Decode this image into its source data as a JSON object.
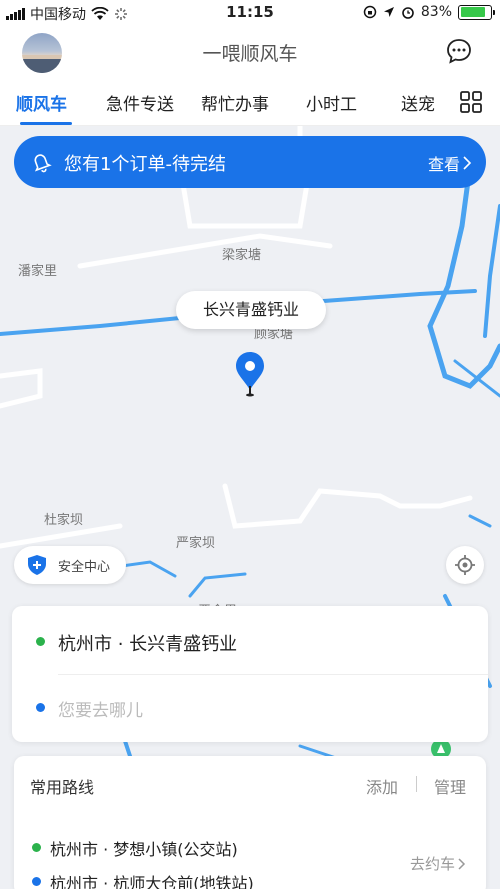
{
  "status_bar": {
    "carrier": "中国移动",
    "time": "11:15",
    "battery": "83%",
    "battery_level": 0.83
  },
  "header": {
    "title": "一喂顺风车"
  },
  "tabs": [
    {
      "label": "顺风车",
      "active": true
    },
    {
      "label": "急件专送"
    },
    {
      "label": "帮忙办事"
    },
    {
      "label": "小时工"
    },
    {
      "label": "送宠"
    }
  ],
  "banner": {
    "text": "您有1个订单-待完结",
    "action": "查看"
  },
  "map": {
    "places": [
      "梁家塘",
      "潘家里",
      "顾家塘",
      "杜家坝",
      "严家坝",
      "严金里"
    ],
    "current_location": "长兴青盛钙业"
  },
  "safety": {
    "label": "安全中心"
  },
  "route_card": {
    "from": "杭州市 · 长兴青盛钙业",
    "to_placeholder": "您要去哪儿"
  },
  "common_routes": {
    "title": "常用路线",
    "add": "添加",
    "manage": "管理",
    "routes": [
      {
        "from": "杭州市 · 梦想小镇(公交站)",
        "to": "杭州市 · 杭师大仓前(地铁站)"
      }
    ],
    "go": "去约车"
  },
  "colors": {
    "accent": "#1a73e8",
    "origin_dot": "#2bb24c",
    "destination_dot": "#1a73e8",
    "river": "#4aa3f0"
  }
}
